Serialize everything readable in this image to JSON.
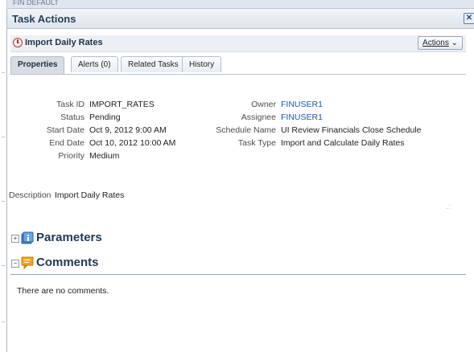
{
  "background": {
    "strip_text": "FIN DEFAULT"
  },
  "dialog": {
    "title": "Task Actions",
    "close_glyph": "✕"
  },
  "task": {
    "title": "Import Daily Rates",
    "actions_label": "Actions"
  },
  "tabs": [
    {
      "label": "Properties",
      "active": true
    },
    {
      "label": "Alerts (0)",
      "active": false
    },
    {
      "label": "Related Tasks",
      "active": false
    },
    {
      "label": "History",
      "active": false
    }
  ],
  "properties_left": [
    {
      "label": "Task ID",
      "value": "IMPORT_RATES"
    },
    {
      "label": "Status",
      "value": "Pending"
    },
    {
      "label": "Start Date",
      "value": "Oct 9, 2012 9:00 AM"
    },
    {
      "label": "End Date",
      "value": "Oct 10, 2012 10:00 AM"
    },
    {
      "label": "Priority",
      "value": "Medium"
    }
  ],
  "properties_right": [
    {
      "label": "Owner",
      "value": "FINUSER1",
      "link": true
    },
    {
      "label": "Assignee",
      "value": "FINUSER1",
      "link": true
    },
    {
      "label": "Schedule Name",
      "value": "UI Review Financials Close Schedule",
      "link": false
    },
    {
      "label": "Task Type",
      "value": "Import and Calculate Daily Rates",
      "link": false
    }
  ],
  "description": {
    "label": "Description",
    "value": "Import Daily Rates"
  },
  "sections": {
    "parameters": {
      "title": "Parameters",
      "expanded": false,
      "icon": "info-icon"
    },
    "comments": {
      "title": "Comments",
      "expanded": true,
      "icon": "comment-icon",
      "empty_text": "There are no comments."
    }
  },
  "colors": {
    "accent": "#1b5aa8",
    "header_text": "#233a55"
  }
}
